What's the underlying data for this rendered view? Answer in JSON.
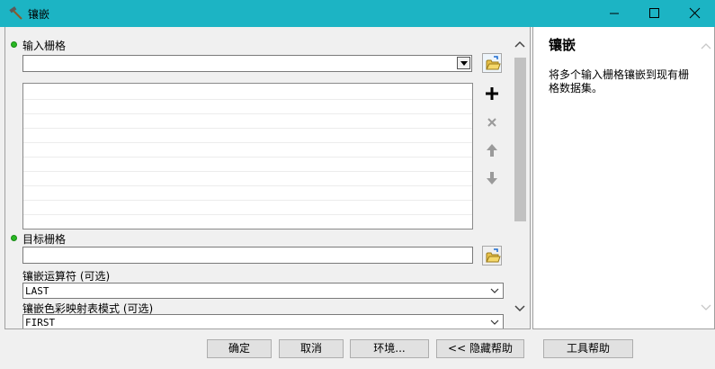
{
  "window": {
    "title": "镶嵌",
    "icon": "hammer-icon",
    "controls": [
      "minimize-icon",
      "maximize-icon",
      "close-icon"
    ],
    "titlebar_color": "#1cb4c4"
  },
  "form": {
    "input_rasters": {
      "label": "输入栅格",
      "required": true,
      "value": "",
      "list_items": []
    },
    "target_raster": {
      "label": "目标栅格",
      "required": true,
      "value": ""
    },
    "mosaic_operator": {
      "label": "镶嵌运算符 (可选)",
      "value": "LAST"
    },
    "colormap_mode": {
      "label": "镶嵌色彩映射表模式 (可选)",
      "value": "FIRST"
    }
  },
  "help": {
    "title": "镶嵌",
    "text": "将多个输入栅格镶嵌到现有栅格数据集。"
  },
  "buttons": {
    "ok": "确定",
    "cancel": "取消",
    "environments": "环境...",
    "hide_help": "<< 隐藏帮助",
    "tool_help": "工具帮助"
  },
  "colors": {
    "required_dot": "#29b824",
    "accent": "#1cb4c4"
  }
}
